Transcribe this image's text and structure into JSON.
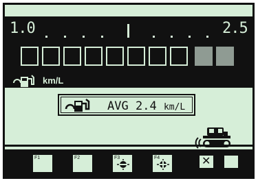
{
  "gauge": {
    "min_label": "1.0",
    "max_label": "2.5",
    "unit": "km/L",
    "segment_count": 10,
    "segments_filled_from_right": 2
  },
  "avg": {
    "label": "AVG",
    "value": "2.4",
    "unit": "km/L"
  },
  "softkeys": [
    {
      "label": "F1",
      "icon": ""
    },
    {
      "label": "F2",
      "icon": ""
    },
    {
      "label": "F3",
      "icon": "lamp-off-icon"
    },
    {
      "label": "F4",
      "icon": "lamp-on-icon"
    }
  ],
  "right_buttons": {
    "close_symbol": "✕"
  },
  "colors": {
    "lcd_background": "#d6eed8",
    "lcd_dark": "#111111",
    "segment_filled": "#8f9b93"
  }
}
